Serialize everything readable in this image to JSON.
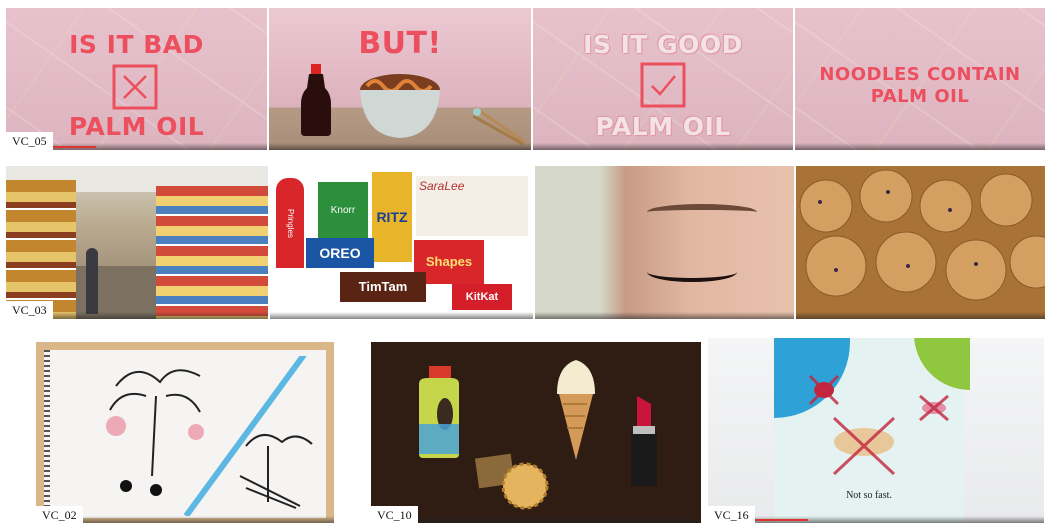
{
  "row1": {
    "label": "VC_05",
    "p1": {
      "line1": "IS IT BAD",
      "line2": "PALM OIL"
    },
    "p2": {
      "text": "BUT!"
    },
    "p3": {
      "line1": "IS IT GOOD",
      "line2": "PALM OIL"
    },
    "p4": {
      "line1": "NOODLES CONTAIN",
      "line2": "PALM OIL"
    }
  },
  "row2": {
    "label": "VC_03",
    "brands": {
      "pringles": "Pringles",
      "oreo": "OREO",
      "ritz": "RITZ",
      "timtam": "TimTam",
      "shapes": "Shapes",
      "kitkat": "KitKat",
      "saralee": "SaraLee",
      "knorr": "Knorr"
    }
  },
  "row3": {
    "label_a": "VC_02",
    "label_b": "VC_10",
    "label_c": "VC_16",
    "caption": "Not so fast."
  },
  "colors": {
    "accent_red": "#ec4f5e",
    "pink_bg": "#e1b9c4",
    "dark_bg": "#2f1d14",
    "progress": "#e0322f"
  },
  "icons": [
    "cross-icon",
    "check-icon",
    "soy-sauce-bottle-icon",
    "noodle-bowl-icon",
    "chopsticks-icon",
    "detergent-bottle-icon",
    "ice-cream-cone-icon",
    "lipstick-icon",
    "biscuit-icon"
  ]
}
